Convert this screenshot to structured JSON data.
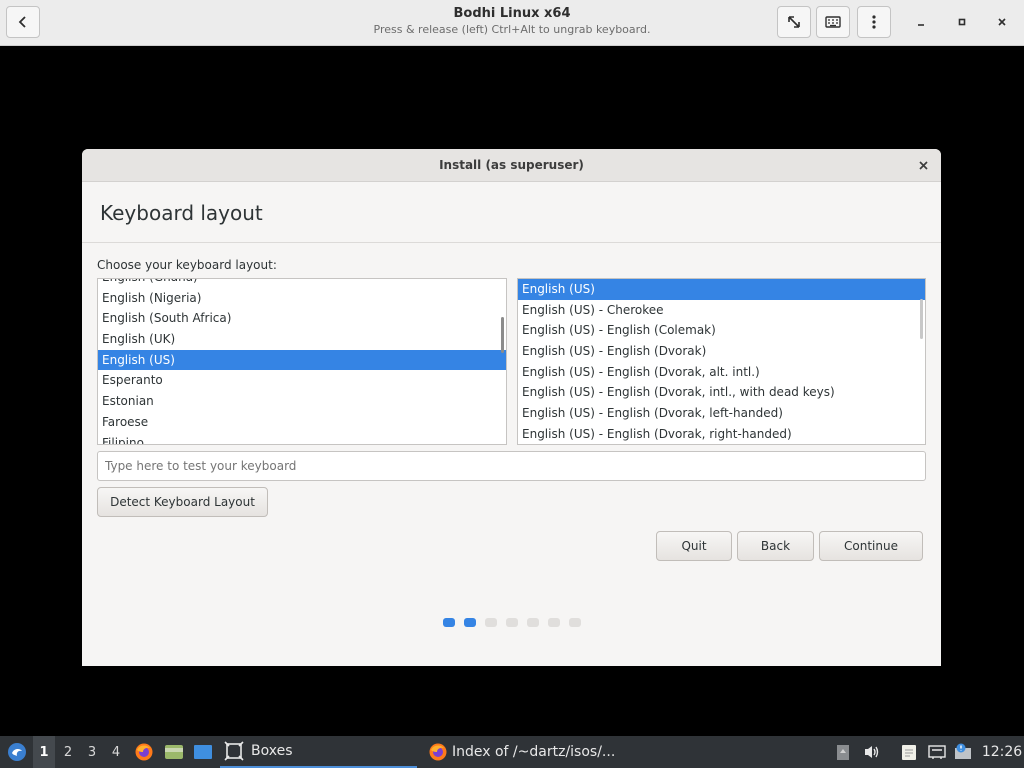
{
  "header": {
    "title": "Bodhi Linux x64",
    "subtitle": "Press & release (left) Ctrl+Alt to ungrab keyboard."
  },
  "dialog": {
    "title": "Install (as superuser)",
    "heading": "Keyboard layout",
    "prompt": "Choose your keyboard layout:",
    "languages": [
      "English (Ghana)",
      "English (Nigeria)",
      "English (South Africa)",
      "English (UK)",
      "English (US)",
      "Esperanto",
      "Estonian",
      "Faroese",
      "Filipino"
    ],
    "selected_language": "English (US)",
    "variants": [
      "English (US)",
      "English (US) - Cherokee",
      "English (US) - English (Colemak)",
      "English (US) - English (Dvorak)",
      "English (US) - English (Dvorak, alt. intl.)",
      "English (US) - English (Dvorak, intl., with dead keys)",
      "English (US) - English (Dvorak, left-handed)",
      "English (US) - English (Dvorak, right-handed)"
    ],
    "selected_variant": "English (US)",
    "test_placeholder": "Type here to test your keyboard",
    "detect_label": "Detect Keyboard Layout",
    "quit_label": "Quit",
    "back_label": "Back",
    "continue_label": "Continue",
    "progress": {
      "current_step": 2,
      "total_steps": 7
    }
  },
  "taskbar": {
    "workspaces": [
      "1",
      "2",
      "3",
      "4"
    ],
    "active_workspace": "1",
    "tasks": [
      "Boxes",
      "Index of /~dartz/isos/..."
    ],
    "clock": "12:26"
  },
  "colors": {
    "accent": "#3584e4",
    "taskbar": "#2f3337"
  }
}
